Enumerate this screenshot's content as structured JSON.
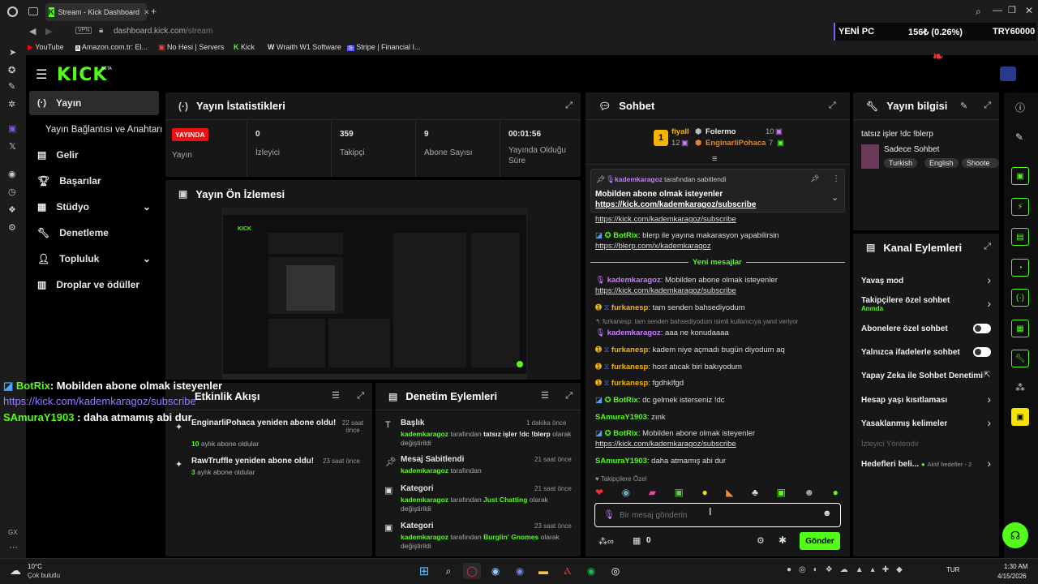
{
  "browser": {
    "tab_title": "Stream - Kick Dashboard",
    "vpn": "VPN",
    "url_domain": "dashboard.kick.com",
    "url_path": "/stream"
  },
  "ticker": {
    "name": "YENİ PC",
    "value": "156₺ (0.26%)",
    "target": "TRY60000"
  },
  "bookmarks": [
    "YouTube",
    "Amazon.com.tr: El...",
    "No Hesi | Servers",
    "Kick",
    "Wraith W1 Software",
    "Stripe | Financial I..."
  ],
  "brand": {
    "logo": "KICK",
    "beta": "BETA"
  },
  "nav": {
    "stream": "Yayın",
    "stream_sub": "Yayın Bağlantısı ve Anahtarı",
    "income": "Gelir",
    "achievements": "Başarılar",
    "studio": "Stüdyo",
    "moderation": "Denetleme",
    "community": "Topluluk",
    "drops": "Droplar ve ödüller"
  },
  "stats": {
    "title": "Yayın İstatistikleri",
    "live_badge": "YAYINDA",
    "live_label": "Yayın",
    "viewers_value": "0",
    "viewers_label": "İzleyici",
    "followers_value": "359",
    "followers_label": "Takipçi",
    "subs_value": "9",
    "subs_label": "Abone Sayısı",
    "uptime_value": "00:01:56",
    "uptime_label": "Yayında Olduğu Süre"
  },
  "preview": {
    "title": "Yayın Ön İzlemesi"
  },
  "overlay": {
    "user1": "BotRix",
    "msg1": ": Mobilden abone olmak isteyenler",
    "link1": "https://kick.com/kademkaragoz/subscribe",
    "user2": "SAmuraY1903",
    "msg2": ": daha atmamış abi dur"
  },
  "activity": {
    "title": "Etkinlik Akışı",
    "items": [
      {
        "text": "EnginarliPohaca yeniden abone oldu!",
        "sub_num": "10",
        "sub_text": "aylık abone oldular",
        "time": "22 saat önce"
      },
      {
        "text": "RawTruffle yeniden abone oldu!",
        "sub_num": "3",
        "sub_text": "aylık abone oldular",
        "time": "23 saat önce"
      }
    ]
  },
  "modlog": {
    "title": "Denetim Eylemleri",
    "items": [
      {
        "title": "Başlık",
        "time": "1 dakika önce",
        "user": "kademkaragoz",
        "mid": "tarafından",
        "value": "tatsız işler !dc !blerp",
        "tail": "olarak değiştirildi"
      },
      {
        "title": "Mesaj Sabitlendi",
        "time": "21 saat önce",
        "user": "kademkaragoz",
        "mid": "tarafından",
        "value": "",
        "tail": ""
      },
      {
        "title": "Kategori",
        "time": "21 saat önce",
        "user": "kademkaragoz",
        "mid": "tarafından",
        "value": "Just Chatting",
        "tail": "olarak değiştirildi"
      },
      {
        "title": "Kategori",
        "time": "23 saat önce",
        "user": "kademkaragoz",
        "mid": "tarafından",
        "value": "Burglin' Gnomes",
        "tail": "olarak değiştirildi"
      }
    ]
  },
  "chat": {
    "title": "Sohbet",
    "top1_name": "fiyall",
    "top1_count": "12",
    "top2_name": "Folermo",
    "top2_count": "10",
    "top3_name": "EnginarliPohaca",
    "top3_count": "7",
    "rank1": "1",
    "pinned_by": "kademkaragoz",
    "pinned_suffix": "tarafından sabitlendi",
    "pinned_text": "Mobilden abone olmak isteyenler",
    "pinned_link": "https://kick.com/kademkaragoz/subscribe",
    "new_messages": "Yeni mesajlar",
    "reply_hint": "furkanesp: tam senden bahsediyodum isimli kullanıcıya yanıt veriyor",
    "followers_only": "Takipçilere Özel",
    "input_placeholder": "Bir mesaj gönderin",
    "points": "0",
    "send": "Gönder",
    "messages": [
      {
        "user": "",
        "text": "",
        "link": "https://kick.com/kademkaragoz/subscribe"
      },
      {
        "user": "BotRix",
        "text": ": blerp ile yayına makarasyon yapabilirsin",
        "link": "https://blerp.com/x/kademkaragoz"
      },
      {
        "user": "kademkaragoz",
        "text": ": Mobilden abone olmak isteyenler",
        "link": "https://kick.com/kademkaragoz/subscribe"
      },
      {
        "user": "furkanesp",
        "text": ": tam senden bahsediyodum",
        "link": ""
      },
      {
        "user": "kademkaragoz",
        "text": ": aaa ne konudaaaa",
        "link": ""
      },
      {
        "user": "furkanesp",
        "text": ": kadem niye açmadı bugün diyodum aq",
        "link": ""
      },
      {
        "user": "furkanesp",
        "text": ": host atıcak biri bakıyodum",
        "link": ""
      },
      {
        "user": "furkanesp",
        "text": ": fgdhklfgd",
        "link": ""
      },
      {
        "user": "BotRix",
        "text": ": dc gelmek isterseniz !dc",
        "link": ""
      },
      {
        "user": "SAmuraY1903",
        "text": ": zınk",
        "link": ""
      },
      {
        "user": "BotRix",
        "text": ": Mobilden abone olmak isteyenler",
        "link": "https://kick.com/kademkaragoz/subscribe"
      },
      {
        "user": "SAmuraY1903",
        "text": ": daha atmamış abi dur",
        "link": ""
      }
    ]
  },
  "info": {
    "title": "Yayın bilgisi",
    "stream_title": "tatsız işler !dc !blerp",
    "category": "Sadece Sohbet",
    "tags": [
      "Turkish",
      "English",
      "Shoote"
    ]
  },
  "actions": {
    "title": "Kanal Eylemleri",
    "slow": "Yavaş mod",
    "followers": "Takipçilere özel sohbet",
    "followers_state": "Anında",
    "subs": "Abonelere özel sohbet",
    "emotes": "Yalnızca ifadelerle sohbet",
    "ai": "Yapay Zeka ile Sohbet Denetimi",
    "age": "Hesap yaşı kısıtlaması",
    "banned": "Yasaklanmış kelimeler",
    "viewer_dir": "İzleyici Yönlendir",
    "goals": "Hedefleri beli...",
    "goals_state": "Aktif hedefler - 2"
  },
  "system": {
    "temp": "10°C",
    "weather": "Çok bulutlu",
    "lang": "TUR",
    "time": "1:30 AM",
    "date": "4/15/2026",
    "gx": "GX"
  },
  "colors": {
    "kick_green": "#53fc18",
    "bg": "#0b0b0b",
    "panel": "#171717",
    "purple": "#c77dff",
    "gold": "#f5b400"
  }
}
